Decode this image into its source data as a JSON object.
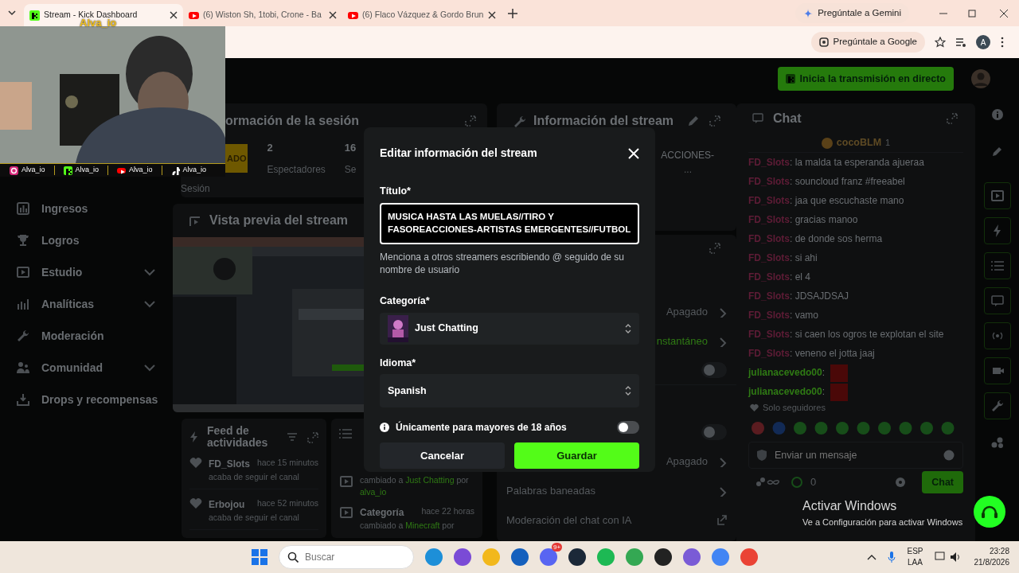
{
  "browser": {
    "tabs": [
      {
        "title": "Stream - Kick Dashboard",
        "selected": true
      },
      {
        "title": "(6) Wiston Sh, 1tobi, Crone - Ba",
        "selected": false
      },
      {
        "title": "(6) Flaco Vázquez & Gordo Brun",
        "selected": false
      }
    ],
    "gemini": "Pregúntale a Gemini",
    "google": "Pregúntale a Google",
    "profile": "A"
  },
  "webcam": {
    "label": "Alva_io",
    "socials": [
      {
        "handle": "Alva_io"
      },
      {
        "handle": "Alva_io"
      },
      {
        "handle": "Alva_io"
      },
      {
        "handle": "Alva_io"
      }
    ]
  },
  "topbar": {
    "go_live": "Inicia la transmisión en directo"
  },
  "sidebar": {
    "items": [
      {
        "label": "Ingresos",
        "expandable": false
      },
      {
        "label": "Logros",
        "expandable": false
      },
      {
        "label": "Estudio",
        "expandable": true
      },
      {
        "label": "Analíticas",
        "expandable": true
      },
      {
        "label": "Moderación",
        "expandable": false
      },
      {
        "label": "Comunidad",
        "expandable": true
      },
      {
        "label": "Drops y recompensas",
        "expandable": false
      }
    ]
  },
  "session": {
    "title": "ormación de la sesión",
    "badge": "ADO",
    "stats": [
      {
        "value": "2",
        "label": "Espectadores"
      },
      {
        "value": "16",
        "label": "Se"
      }
    ],
    "footer": "Sesión"
  },
  "preview": {
    "title": "Vista previa del stream"
  },
  "feed": {
    "title": "Feed de actividades",
    "items": [
      {
        "user": "FD_Slots",
        "time": "hace 15 minutos",
        "text": "acaba de seguir el canal"
      },
      {
        "user": "Erbojou",
        "time": "hace 52 minutos",
        "text": "acaba de seguir el canal"
      }
    ]
  },
  "changes": {
    "items": [
      {
        "parts": [
          {
            "text": "cambiado a",
            "accent": false
          },
          {
            "text": "Just Chatting",
            "accent": true
          },
          {
            "text": "por",
            "accent": false
          },
          {
            "text": "alva_io",
            "accent": true
          }
        ]
      },
      {
        "title": "Categoría",
        "time": "hace 22 horas",
        "parts": [
          {
            "text": "cambiado a",
            "accent": false
          },
          {
            "text": "Minecraft",
            "accent": true
          },
          {
            "text": "por",
            "accent": false
          }
        ]
      }
    ]
  },
  "stream_info": {
    "title": "Información del stream",
    "snippet": "ACCIONES-",
    "more": "..."
  },
  "moderation": {
    "rows": [
      {
        "kind": "value",
        "value": "Apagado",
        "accent": false
      },
      {
        "kind": "value",
        "value": "nstantáneo",
        "accent": true
      },
      {
        "kind": "toggle",
        "on": false
      },
      {
        "kind": "toggle",
        "on": false
      },
      {
        "kind": "value",
        "value": "Apagado",
        "accent": false
      },
      {
        "kind": "link",
        "label": "Palabras baneadas"
      },
      {
        "kind": "external",
        "label": "Moderación del chat con IA"
      }
    ]
  },
  "chat": {
    "title": "Chat",
    "pinned": {
      "user": "cocoBLM",
      "count": "1"
    },
    "messages": [
      {
        "user": "FD_Slots",
        "separator": ":",
        "color": "#5e1c36",
        "kind": "text",
        "text": "la malda ta esperanda ajueraa"
      },
      {
        "user": "FD_Slots",
        "separator": ":",
        "color": "#5e1c36",
        "kind": "text",
        "text": "souncloud franz #freeabel"
      },
      {
        "user": "FD_Slots",
        "separator": ":",
        "color": "#5e1c36",
        "kind": "text",
        "text": "jaa que escuchaste mano"
      },
      {
        "user": "FD_Slots",
        "separator": ":",
        "color": "#5e1c36",
        "kind": "text",
        "text": "gracias manoo"
      },
      {
        "user": "FD_Slots",
        "separator": ":",
        "color": "#5e1c36",
        "kind": "text",
        "text": "de donde sos herma"
      },
      {
        "user": "FD_Slots",
        "separator": ":",
        "color": "#5e1c36",
        "kind": "text",
        "text": "si ahi"
      },
      {
        "user": "FD_Slots",
        "separator": ":",
        "color": "#5e1c36",
        "kind": "text",
        "text": "el 4"
      },
      {
        "user": "FD_Slots",
        "separator": ":",
        "color": "#5e1c36",
        "kind": "text",
        "text": "JDSAJDSAJ"
      },
      {
        "user": "FD_Slots",
        "separator": ":",
        "color": "#5e1c36",
        "kind": "text",
        "text": "vamo"
      },
      {
        "user": "FD_Slots",
        "separator": ":",
        "color": "#5e1c36",
        "kind": "text",
        "text": "si caen los ogros te explotan el site"
      },
      {
        "user": "FD_Slots",
        "separator": ":",
        "color": "#5e1c36",
        "kind": "text",
        "text": "veneno el jotta jaaj"
      },
      {
        "user": "julianacevedo00",
        "separator": ":",
        "color": "#2f7a14",
        "kind": "emote"
      },
      {
        "user": "julianacevedo00",
        "separator": ":",
        "color": "#2f7a14",
        "kind": "emote"
      }
    ],
    "mode": "Solo seguidores",
    "placeholder": "Enviar un mensaje",
    "count": "0",
    "send": "Chat"
  },
  "modal": {
    "title": "Editar información del stream",
    "title_label": "Título*",
    "title_value": "MUSICA HASTA LAS MUELAS//TIRO Y FASOREACCIONES-ARTISTAS EMERGENTES//FUTBOL",
    "hint": "Menciona a otros streamers escribiendo @ seguido de su nombre de usuario",
    "category_label": "Categoría*",
    "category": "Just Chatting",
    "language_label": "Idioma*",
    "language": "Spanish",
    "adult_label": "Únicamente para mayores de 18 años",
    "adult_only": false,
    "cancel": "Cancelar",
    "save": "Guardar"
  },
  "windows_notice": {
    "title": "Activar Windows",
    "text": "Ve a Configuración para activar Windows"
  },
  "taskbar": {
    "search_placeholder": "Buscar",
    "badge": "9+",
    "lang": "ESP",
    "layout": "LAA",
    "time": "23:28",
    "date": "21/8/2026"
  }
}
